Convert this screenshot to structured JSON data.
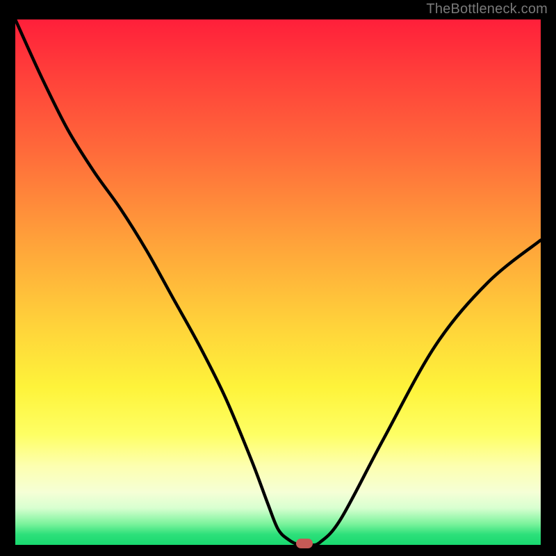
{
  "watermark": "TheBottleneck.com",
  "chart_data": {
    "type": "line",
    "title": "",
    "xlabel": "",
    "ylabel": "",
    "xlim": [
      0,
      100
    ],
    "ylim": [
      0,
      100
    ],
    "grid": false,
    "legend": false,
    "annotations": [],
    "background_gradient": {
      "top_color": "#ff1f3a",
      "bottom_color": "#18d86f",
      "description": "vertical red-to-green gradient (red high bottleneck, green low)"
    },
    "series": [
      {
        "name": "bottleneck-curve",
        "color": "#000000",
        "x": [
          0,
          5,
          10,
          15,
          20,
          25,
          30,
          35,
          40,
          45,
          48,
          50,
          52,
          54,
          56,
          58,
          62,
          70,
          80,
          90,
          100
        ],
        "y": [
          100,
          89,
          79,
          71,
          64,
          56,
          47,
          38,
          28,
          16,
          8,
          3,
          1,
          0,
          0,
          0.5,
          5,
          20,
          38,
          50,
          58
        ]
      }
    ],
    "marker": {
      "x": 55,
      "y": 0,
      "color": "#c55a56",
      "shape": "pill"
    }
  }
}
